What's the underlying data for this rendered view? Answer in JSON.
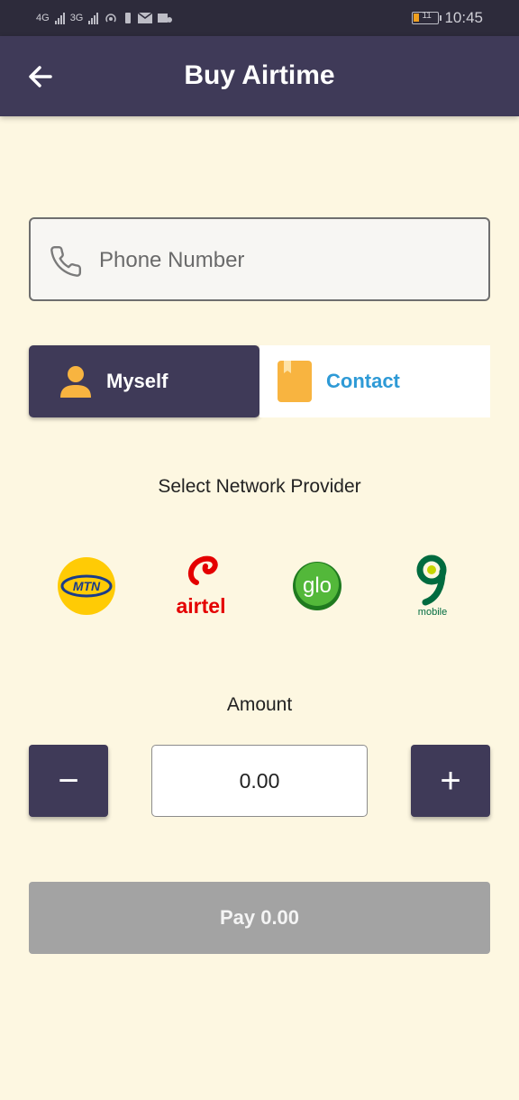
{
  "status_bar": {
    "left_indicators": [
      "4G",
      "3G"
    ],
    "battery_level": "11",
    "time": "10:45"
  },
  "header": {
    "title": "Buy Airtime",
    "back_icon": "arrow-left-icon"
  },
  "phone": {
    "placeholder": "Phone Number",
    "value": "",
    "icon": "phone-icon"
  },
  "recipient": {
    "myself_label": "Myself",
    "contact_label": "Contact",
    "selected": "Myself"
  },
  "providers": {
    "label": "Select Network Provider",
    "items": [
      {
        "name": "MTN",
        "logo_text": "MTN",
        "color": "#ffcb05"
      },
      {
        "name": "airtel",
        "logo_text": "airtel",
        "color": "#e40000"
      },
      {
        "name": "glo",
        "logo_text": "glo",
        "color": "#2d8f2d"
      },
      {
        "name": "9mobile",
        "logo_text": "mobile",
        "color": "#006b3f"
      }
    ]
  },
  "amount": {
    "label": "Amount",
    "value": "0.00",
    "decrement_label": "−",
    "increment_label": "+"
  },
  "pay": {
    "label": "Pay 0.00"
  },
  "colors": {
    "background": "#fdf7e1",
    "primary": "#3f3a58",
    "accent_blue": "#2e9ad6",
    "icon_orange": "#f8b440",
    "disabled": "#a3a3a3"
  }
}
